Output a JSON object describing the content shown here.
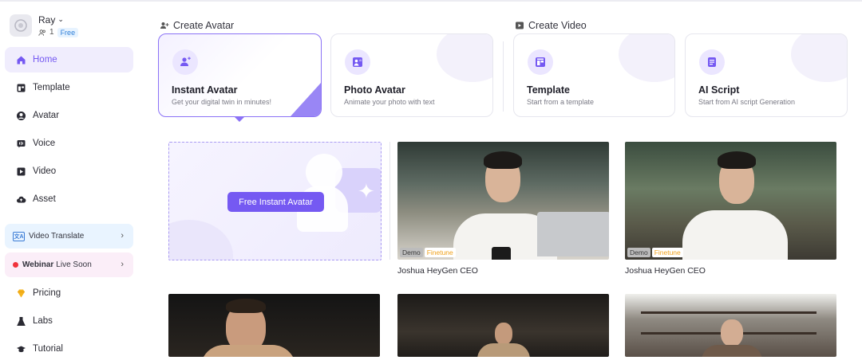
{
  "user": {
    "name": "Ray",
    "member_count": "1",
    "plan": "Free"
  },
  "sidebar": {
    "items": [
      {
        "label": "Home",
        "icon": "home-icon",
        "active": true
      },
      {
        "label": "Template",
        "icon": "template-icon"
      },
      {
        "label": "Avatar",
        "icon": "avatar-icon"
      },
      {
        "label": "Voice",
        "icon": "voice-icon"
      },
      {
        "label": "Video",
        "icon": "video-icon"
      },
      {
        "label": "Asset",
        "icon": "asset-icon"
      }
    ],
    "promos": {
      "translate": {
        "icon_text": "文A",
        "label": "Video Translate"
      },
      "webinar": {
        "bold": "Webinar",
        "label": "Live Soon"
      }
    },
    "items2": [
      {
        "label": "Pricing",
        "icon": "pricing-icon"
      },
      {
        "label": "Labs",
        "icon": "labs-icon"
      },
      {
        "label": "Tutorial",
        "icon": "tutorial-icon"
      }
    ]
  },
  "sections": {
    "create_avatar": "Create Avatar",
    "create_video": "Create Video"
  },
  "cards": [
    {
      "title": "Instant Avatar",
      "subtitle": "Get your digital twin in minutes!",
      "selected": true
    },
    {
      "title": "Photo Avatar",
      "subtitle": "Animate your photo with text"
    },
    {
      "title": "Template",
      "subtitle": "Start from a template"
    },
    {
      "title": "AI Script",
      "subtitle": "Start from AI script Generation"
    }
  ],
  "free_instant_avatar": {
    "button_label": "Free Instant Avatar"
  },
  "avatars": [
    {
      "name": "Joshua HeyGen CEO",
      "tags": [
        "Demo",
        "Finetune"
      ]
    },
    {
      "name": "Joshua HeyGen CEO",
      "tags": [
        "Demo",
        "Finetune"
      ]
    }
  ],
  "colors": {
    "accent": "#7559f2",
    "finetune": "#f0a21c",
    "active_bg": "#f0edfd"
  }
}
